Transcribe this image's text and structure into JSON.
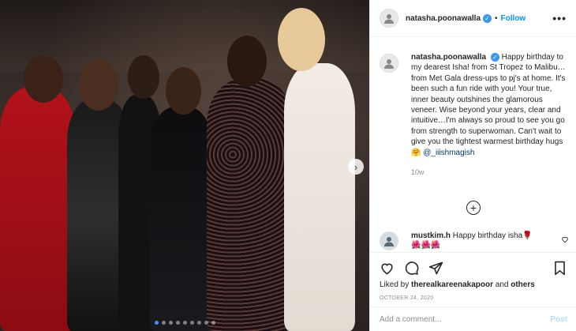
{
  "post": {
    "username": "natasha.poonawalla",
    "follow_label": "Follow",
    "more_label": "•••"
  },
  "caption": {
    "username": "natasha.poonawalla",
    "text": "Happy birthday to my dearest Isha! from St Tropez to Malibu… from Met Gala dress-ups to pj's at home. It's been such a fun ride with you! Your true, inner beauty outshines the glamorous veneer. Wise beyond your years, clear and intuitive…I'm always so proud to see you go from strength to superwoman. Can't wait to give you the tightest warmest birthday hugs 🤗",
    "mention": "@_iiishmagish",
    "time": "10w"
  },
  "comment": {
    "username": "mustkim.h",
    "text": "Happy birthday isha🌹",
    "emoji_line": "🌺🌺🌺"
  },
  "actions": {
    "liked_by_prefix": "Liked by",
    "liked_by_user": "therealkareenakapoor",
    "liked_by_suffix": "and",
    "liked_by_others": "others",
    "date": "OCTOBER 24, 2020"
  },
  "add_comment": {
    "placeholder": "Add a comment...",
    "post_label": "Post"
  },
  "carousel": {
    "dot_count": 9,
    "active_index": 0,
    "next_icon": "chevron-right-icon"
  },
  "colors": {
    "accent": "#0095f6",
    "verified": "#3897f0",
    "post_disabled": "#b2dffc"
  }
}
